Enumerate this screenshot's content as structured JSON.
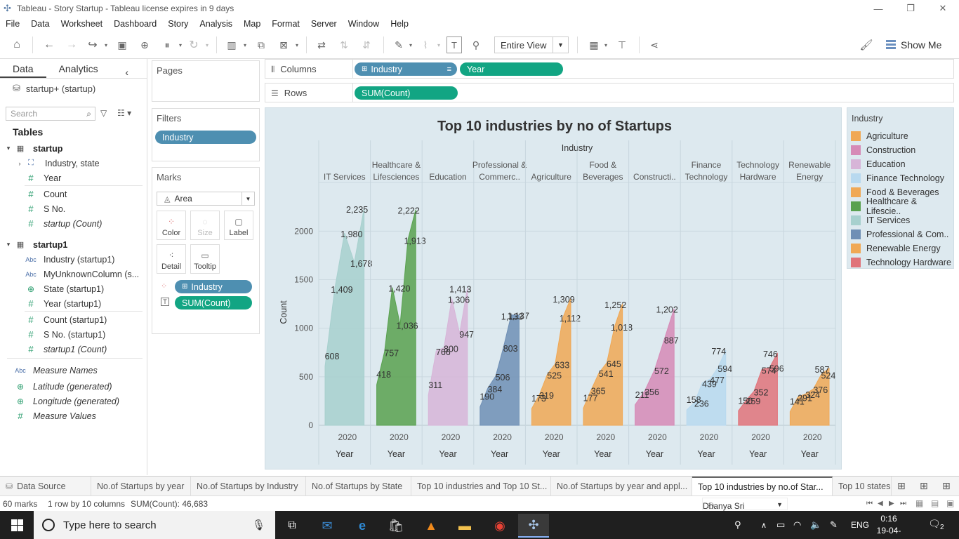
{
  "window": {
    "title": "Tableau - Story Startup - Tableau license expires in 9 days",
    "minimize": "—",
    "restore": "❐",
    "close": "✕"
  },
  "menu": [
    "File",
    "Data",
    "Worksheet",
    "Dashboard",
    "Story",
    "Analysis",
    "Map",
    "Format",
    "Server",
    "Window",
    "Help"
  ],
  "toolbar": {
    "fit_select": "Entire View",
    "show_me": "Show Me"
  },
  "data_pane": {
    "tabs": [
      "Data",
      "Analytics"
    ],
    "datasource": "startup+ (startup)",
    "search_placeholder": "Search",
    "tables_heading": "Tables",
    "groups": [
      {
        "name": "startup",
        "fields": [
          {
            "type": "hier",
            "label": "Industry, state"
          },
          {
            "type": "num",
            "label": "Year"
          },
          {
            "type": "num",
            "label": "Count"
          },
          {
            "type": "num",
            "label": "S No."
          },
          {
            "type": "num",
            "label": "startup (Count)",
            "italic": true
          }
        ]
      },
      {
        "name": "startup1",
        "fields": [
          {
            "type": "abc",
            "label": "Industry (startup1)"
          },
          {
            "type": "abc",
            "label": "MyUnknownColumn (s..."
          },
          {
            "type": "geo",
            "label": "State (startup1)"
          },
          {
            "type": "num",
            "label": "Year (startup1)"
          },
          {
            "type": "num",
            "label": "Count (startup1)"
          },
          {
            "type": "num",
            "label": "S No. (startup1)"
          },
          {
            "type": "num",
            "label": "startup1 (Count)",
            "italic": true
          }
        ]
      }
    ],
    "extra_fields": [
      {
        "type": "abc",
        "label": "Measure Names"
      },
      {
        "type": "geo",
        "label": "Latitude (generated)"
      },
      {
        "type": "geo",
        "label": "Longitude (generated)"
      },
      {
        "type": "num",
        "label": "Measure Values"
      }
    ]
  },
  "cards": {
    "pages": "Pages",
    "filters": "Filters",
    "filter_pill": "Industry",
    "marks": "Marks",
    "mark_type": "Area",
    "mark_buttons": [
      "Color",
      "Size",
      "Label",
      "Detail",
      "Tooltip"
    ],
    "mark_pills": [
      "Industry",
      "SUM(Count)"
    ]
  },
  "shelves": {
    "columns_label": "Columns",
    "rows_label": "Rows",
    "columns_pills": [
      "Industry",
      "Year"
    ],
    "rows_pills": [
      "SUM(Count)"
    ]
  },
  "chart_data": {
    "type": "area",
    "title": "Top 10 industries by no of Startups",
    "column_header": "Industry",
    "ylabel": "Count",
    "xlabel": "Year",
    "x_tick": "2020",
    "y_ticks": [
      0,
      500,
      1000,
      1500,
      2000
    ],
    "ylim": [
      0,
      2400
    ],
    "panels": [
      {
        "name": "IT Services",
        "color": "#a7d0ce",
        "values": [
          608,
          1409,
          1980,
          1678,
          2235
        ]
      },
      {
        "name": "Healthcare & Lifesciences",
        "color": "#59a14f",
        "values": [
          418,
          757,
          1420,
          1036,
          1913,
          2222
        ]
      },
      {
        "name": "Education",
        "color": "#d7b5d8",
        "values": [
          311,
          766,
          800,
          1306,
          947,
          1413
        ]
      },
      {
        "name": "Professional & Commerc..",
        "color": "#6f8fb5",
        "values": [
          190,
          384,
          506,
          803,
          1137,
          1133
        ]
      },
      {
        "name": "Agriculture",
        "color": "#f0a855",
        "values": [
          173,
          319,
          525,
          633,
          1112,
          1309
        ]
      },
      {
        "name": "Food & Beverages",
        "color": "#f0a855",
        "values": [
          177,
          365,
          541,
          645,
          1018,
          1252
        ]
      },
      {
        "name": "Constructi..",
        "color": "#d68ab6",
        "values": [
          211,
          356,
          572,
          887,
          1202
        ]
      },
      {
        "name": "Finance Technology",
        "color": "#b8d9ef",
        "values": [
          158,
          236,
          439,
          477,
          594,
          774
        ]
      },
      {
        "name": "Technology Hardware",
        "color": "#e0737a",
        "values": [
          150,
          259,
          352,
          574,
          596,
          746
        ]
      },
      {
        "name": "Renewable Energy",
        "color": "#f0a855",
        "values": [
          141,
          291,
          324,
          376,
          524,
          587
        ]
      }
    ]
  },
  "legend": {
    "title": "Industry",
    "items": [
      {
        "label": "Agriculture",
        "color": "#f0a855"
      },
      {
        "label": "Construction",
        "color": "#d68ab6"
      },
      {
        "label": "Education",
        "color": "#d7b5d8"
      },
      {
        "label": "Finance Technology",
        "color": "#b8d9ef"
      },
      {
        "label": "Food & Beverages",
        "color": "#f0a855"
      },
      {
        "label": "Healthcare & Lifescie..",
        "color": "#59a14f"
      },
      {
        "label": "IT Services",
        "color": "#a7d0ce"
      },
      {
        "label": "Professional & Com..",
        "color": "#6f8fb5"
      },
      {
        "label": "Renewable Energy",
        "color": "#f0a855"
      },
      {
        "label": "Technology Hardware",
        "color": "#e0737a"
      }
    ]
  },
  "sheet_tabs": [
    "Data Source",
    "No.of Startups by year",
    "No.of Startups by Industry",
    "No.of Startups by State",
    "Top 10 industries and Top 10 St...",
    "No.of Startups by year and appl...",
    "Top 10 industries by no.of Star...",
    "Top 10 states"
  ],
  "active_tab_index": 6,
  "status": {
    "marks": "60 marks",
    "layout": "1 row by 10 columns",
    "sum": "SUM(Count): 46,683",
    "user": "Dhanya Sri"
  },
  "taskbar": {
    "search_placeholder": "Type here to search",
    "language": "ENG",
    "time": "0:16",
    "date": "19-04-2023",
    "notifications": "2"
  }
}
